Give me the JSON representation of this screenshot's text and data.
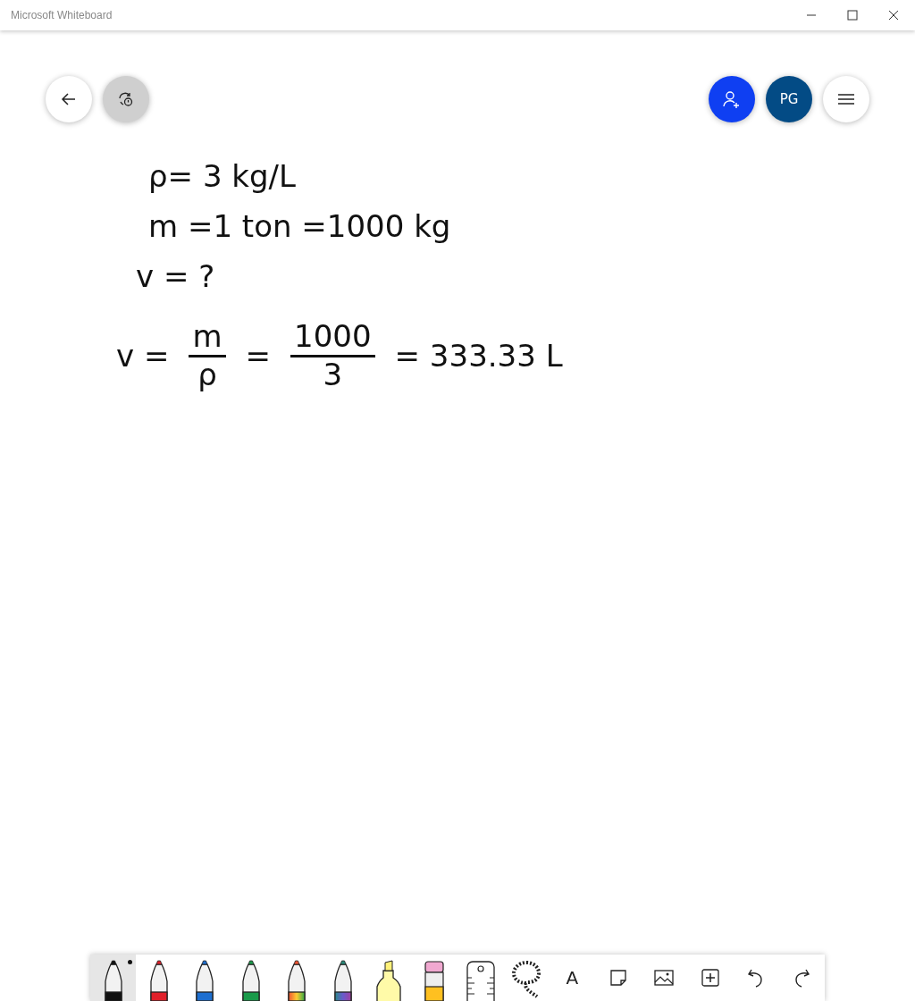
{
  "window": {
    "title": "Microsoft Whiteboard"
  },
  "top_right": {
    "avatar_initials": "PG"
  },
  "ink": [
    {
      "kind": "line",
      "text": "ρ= 3 kg/L"
    },
    {
      "kind": "line",
      "text": "m =1 ton =1000 kg"
    },
    {
      "kind": "line",
      "text": "v = ?"
    },
    {
      "kind": "equation",
      "parts": [
        {
          "kind": "text",
          "text": "v ="
        },
        {
          "kind": "fraction",
          "numerator": "m",
          "denominator": "ρ"
        },
        {
          "kind": "text",
          "text": "="
        },
        {
          "kind": "fraction",
          "numerator": "1000",
          "denominator": "3"
        },
        {
          "kind": "text",
          "text": "= 333.33 L"
        }
      ]
    }
  ],
  "toolbar": [
    {
      "kind": "pen",
      "color": "#111111",
      "selected": true
    },
    {
      "kind": "pen",
      "color": "#e0202a",
      "selected": false
    },
    {
      "kind": "pen",
      "color": "#1e6fd0",
      "selected": false
    },
    {
      "kind": "pen",
      "color": "#1a9a4a",
      "selected": false
    },
    {
      "kind": "rainbow-pen",
      "selected": false
    },
    {
      "kind": "galaxy-pen",
      "selected": false
    },
    {
      "kind": "highlighter",
      "selected": false
    },
    {
      "kind": "eraser",
      "selected": false
    },
    {
      "kind": "ruler",
      "selected": false
    },
    {
      "kind": "lasso",
      "selected": false
    },
    {
      "kind": "text",
      "glyph": "A",
      "selected": false
    },
    {
      "kind": "note",
      "selected": false
    },
    {
      "kind": "image",
      "selected": false
    },
    {
      "kind": "add",
      "selected": false
    },
    {
      "kind": "undo",
      "selected": false
    },
    {
      "kind": "redo",
      "selected": false
    }
  ]
}
